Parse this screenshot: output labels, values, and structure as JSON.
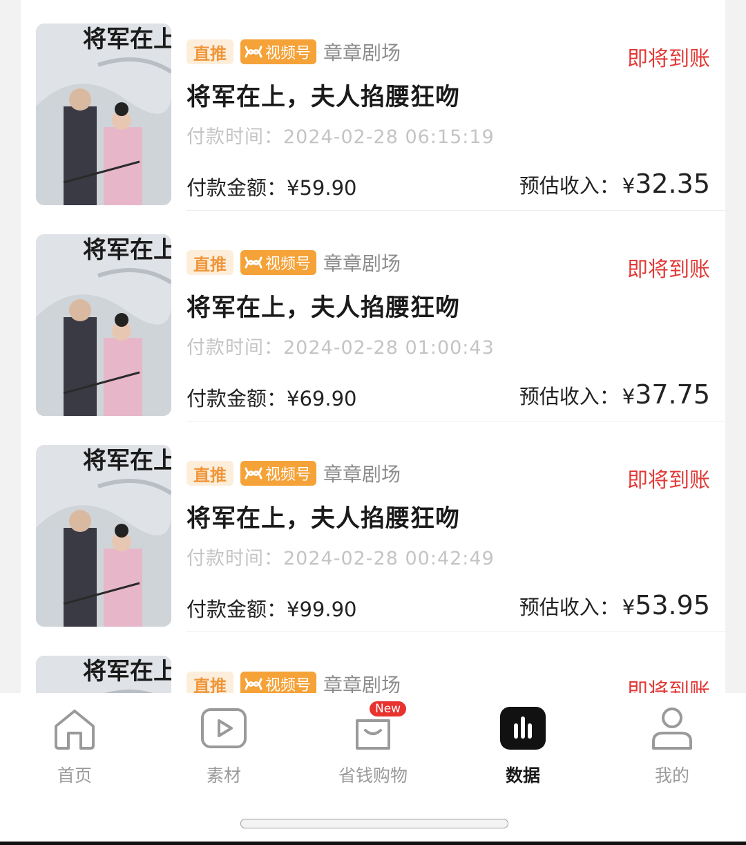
{
  "orders": [
    {
      "tag_direct": "直推",
      "tag_video": "视频号",
      "merchant": "章章剧场",
      "status": "即将到账",
      "title": "将军在上，夫人掐腰狂吻",
      "pay_time_label": "付款时间：",
      "pay_time": "2024-02-28 06:15:19",
      "pay_amount_label": "付款金额：",
      "pay_amount": "¥59.90",
      "income_label": "预估收入：",
      "income_currency": "¥",
      "income_value": "32.35",
      "poster_title": "将军在上，"
    },
    {
      "tag_direct": "直推",
      "tag_video": "视频号",
      "merchant": "章章剧场",
      "status": "即将到账",
      "title": "将军在上，夫人掐腰狂吻",
      "pay_time_label": "付款时间：",
      "pay_time": "2024-02-28 01:00:43",
      "pay_amount_label": "付款金额：",
      "pay_amount": "¥69.90",
      "income_label": "预估收入：",
      "income_currency": "¥",
      "income_value": "37.75",
      "poster_title": "将军在上，"
    },
    {
      "tag_direct": "直推",
      "tag_video": "视频号",
      "merchant": "章章剧场",
      "status": "即将到账",
      "title": "将军在上，夫人掐腰狂吻",
      "pay_time_label": "付款时间：",
      "pay_time": "2024-02-28 00:42:49",
      "pay_amount_label": "付款金额：",
      "pay_amount": "¥99.90",
      "income_label": "预估收入：",
      "income_currency": "¥",
      "income_value": "53.95",
      "poster_title": "将军在上，"
    },
    {
      "tag_direct": "直推",
      "tag_video": "视频号",
      "merchant": "章章剧场",
      "status": "即将到账",
      "poster_title": "将军在上，"
    }
  ],
  "tabbar": {
    "items": [
      {
        "label": "首页",
        "icon": "home-icon"
      },
      {
        "label": "素材",
        "icon": "video-play-icon"
      },
      {
        "label": "省钱购物",
        "icon": "shopping-bag-icon",
        "badge": "New"
      },
      {
        "label": "数据",
        "icon": "bar-chart-icon",
        "active": true
      },
      {
        "label": "我的",
        "icon": "user-icon"
      }
    ]
  },
  "colors": {
    "status_red": "#e03a37",
    "tag_orange": "#f5a238",
    "tag_direct_bg": "#fdeedb",
    "active_tab": "#1a1a1a",
    "inactive_tab": "#9a9a9a"
  }
}
